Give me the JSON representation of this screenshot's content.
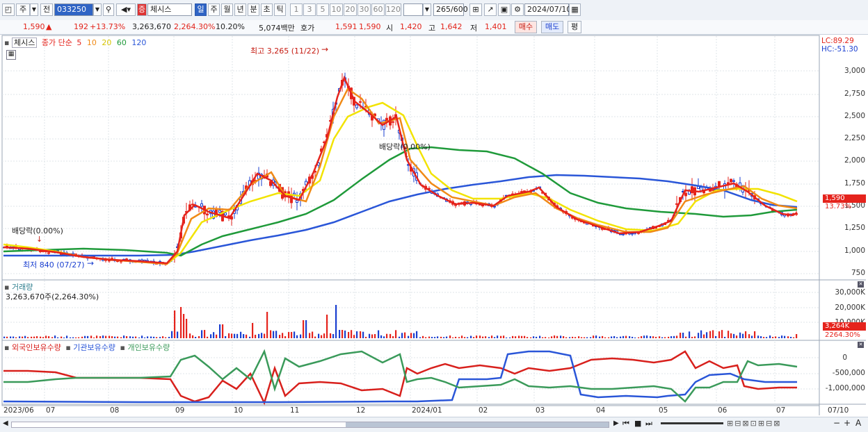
{
  "toolbar": {
    "stock_code": "033250",
    "stock_name": "체시스",
    "market_badge": "증",
    "period_buttons": [
      "일",
      "주",
      "월",
      "년",
      "분",
      "초",
      "틱"
    ],
    "interval_buttons": [
      "1",
      "3",
      "5",
      "10",
      "20",
      "30",
      "60",
      "120"
    ],
    "count_value": "265",
    "count_total": "/600",
    "date_value": "2024/07/10",
    "left_labels": [
      "주",
      "전"
    ]
  },
  "infobar": {
    "price": "1,590",
    "change_arrow": "▲",
    "change": "192",
    "change_pct": "+13.73%",
    "volume": "3,263,670",
    "volume_pct": "2,264.30%",
    "turnover_pct": "10.20%",
    "trade_value": "5,074백만",
    "ask_label": "호가",
    "ask1": "1,591",
    "ask2": "1,590",
    "open_label": "시",
    "open": "1,420",
    "high_label": "고",
    "high": "1,642",
    "low_label": "저",
    "low": "1,401",
    "buy_button": "매수",
    "sell_button": "매도",
    "avg_button": "평"
  },
  "price_panel": {
    "legend_name": "체시스",
    "legend_ma": "종가 단순",
    "ma_periods": [
      "5",
      "10",
      "20",
      "60",
      "120"
    ],
    "ma_colors": [
      "#e5231c",
      "#f08a16",
      "#f2e300",
      "#1f9a3a",
      "#2a56d8"
    ],
    "lc": "LC:89.29",
    "hc": "HC:-51.30",
    "y_ticks": [
      "3,000",
      "2,750",
      "2,500",
      "2,250",
      "2,000",
      "1,750",
      "1,500",
      "1,250",
      "1,000",
      "750"
    ],
    "price_tag": "1,590",
    "pct_tag": "13.73%",
    "annotation_high": "최고 3,265 (11/22)",
    "annotation_low": "최저 840 (07/27)",
    "annotation_div1": "배당락(0.00%)",
    "annotation_div2": "배당락(0.00%)"
  },
  "volume_panel": {
    "title": "거래량",
    "value": "3,263,670주(2,264.30%)",
    "y_ticks": [
      "30,000K",
      "20,000K",
      "10,000K"
    ],
    "tag_value": "3,264K",
    "tag_pct": "2264.30%"
  },
  "holding_panel": {
    "legends": [
      "외국인보유수량",
      "기관보유수량",
      "개인보유수량"
    ],
    "legend_colors": [
      "#d8201c",
      "#2a56d8",
      "#3a9a5a"
    ],
    "y_ticks": [
      "0",
      "-500,000",
      "-1,000,000"
    ]
  },
  "x_axis": {
    "labels": [
      "2023/06",
      "07",
      "08",
      "09",
      "10",
      "11",
      "12",
      "2024/01",
      "02",
      "03",
      "04",
      "05",
      "06",
      "07"
    ],
    "right_label": "07/10"
  }
}
